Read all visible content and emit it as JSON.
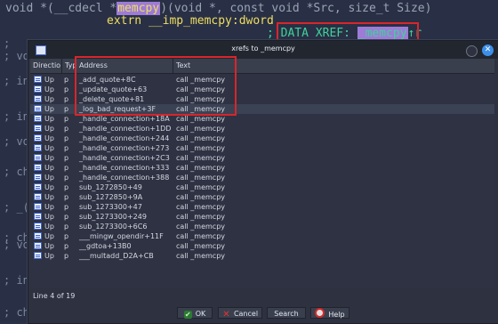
{
  "code_view": {
    "line1_prefix": "void *(__cdecl *",
    "line1_highlight": "memcpy",
    "line1_suffix": ")(void *, const void *Src, size_t Size)",
    "line2": "extrn __imp_memcpy:dword",
    "line3_prefix": "; DATA XREF: ",
    "line3_highlight": "_memcpy",
    "line3_suffix": "↑r",
    "side_fragments": [
      ";",
      "; vo",
      "; in",
      "; in",
      "; vo",
      "; ch",
      "; _(",
      "; ch",
      "; vo",
      "; in",
      "; ch"
    ]
  },
  "dialog": {
    "title": "xrefs to _memcpy",
    "columns": [
      "Directio",
      "Typ",
      "Address",
      "Text"
    ],
    "rows": [
      {
        "direction": "Up",
        "type": "p",
        "address": "_add_quote+8C",
        "text": "call _memcpy"
      },
      {
        "direction": "Up",
        "type": "p",
        "address": "_update_quote+63",
        "text": "call _memcpy"
      },
      {
        "direction": "Up",
        "type": "p",
        "address": "_delete_quote+81",
        "text": "call _memcpy"
      },
      {
        "direction": "Up",
        "type": "p",
        "address": "_log_bad_request+3F",
        "text": "call _memcpy"
      },
      {
        "direction": "Up",
        "type": "p",
        "address": "_handle_connection+18A",
        "text": "call _memcpy"
      },
      {
        "direction": "Up",
        "type": "p",
        "address": "_handle_connection+1DD",
        "text": "call _memcpy"
      },
      {
        "direction": "Up",
        "type": "p",
        "address": "_handle_connection+244",
        "text": "call _memcpy"
      },
      {
        "direction": "Up",
        "type": "p",
        "address": "_handle_connection+273",
        "text": "call _memcpy"
      },
      {
        "direction": "Up",
        "type": "p",
        "address": "_handle_connection+2C3",
        "text": "call _memcpy"
      },
      {
        "direction": "Up",
        "type": "p",
        "address": "_handle_connection+333",
        "text": "call _memcpy"
      },
      {
        "direction": "Up",
        "type": "p",
        "address": "_handle_connection+388",
        "text": "call _memcpy"
      },
      {
        "direction": "Up",
        "type": "p",
        "address": "sub_1272850+49",
        "text": "call _memcpy"
      },
      {
        "direction": "Up",
        "type": "p",
        "address": "sub_1272850+9A",
        "text": "call _memcpy"
      },
      {
        "direction": "Up",
        "type": "p",
        "address": "sub_1273300+47",
        "text": "call _memcpy"
      },
      {
        "direction": "Up",
        "type": "p",
        "address": "sub_1273300+249",
        "text": "call _memcpy"
      },
      {
        "direction": "Up",
        "type": "p",
        "address": "sub_1273300+6C6",
        "text": "call _memcpy"
      },
      {
        "direction": "Up",
        "type": "p",
        "address": "___mingw_opendir+11F",
        "text": "call _memcpy"
      },
      {
        "direction": "Up",
        "type": "p",
        "address": "__gdtoa+13B0",
        "text": "call _memcpy"
      },
      {
        "direction": "Up",
        "type": "p",
        "address": "___multadd_D2A+CB",
        "text": "call _memcpy"
      }
    ],
    "selected_row_index": 3,
    "status": "Line 4 of 19",
    "buttons": {
      "ok": "OK",
      "cancel": "Cancel",
      "search": "Search",
      "help": "Help"
    }
  },
  "colors": {
    "highlight": "#9d7bd6",
    "keyword_yellow": "#f0dd62",
    "comment_green": "#3fd29a",
    "annotation_red": "#d8262b",
    "accent_blue": "#3c8fe9"
  }
}
